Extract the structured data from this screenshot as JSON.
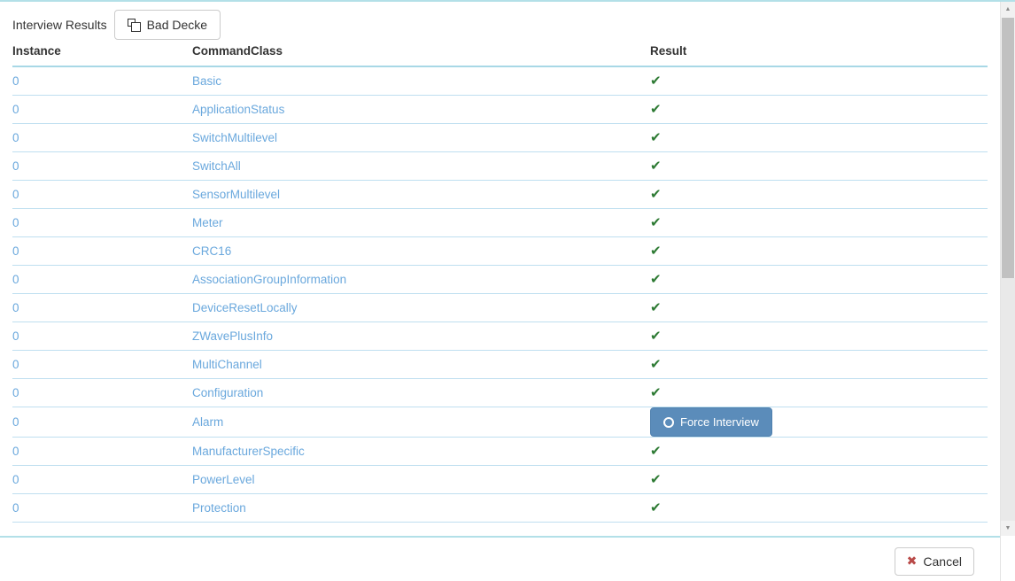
{
  "modal": {
    "title_label": "Interview Results",
    "device_button_label": "Bad Decke",
    "device_button_icon": "clone-icon"
  },
  "table": {
    "headers": {
      "instance": "Instance",
      "command_class": "CommandClass",
      "result": "Result"
    },
    "rows": [
      {
        "instance": "0",
        "command_class": "Basic",
        "result_type": "check",
        "result_icon": "check-icon"
      },
      {
        "instance": "0",
        "command_class": "ApplicationStatus",
        "result_type": "check",
        "result_icon": "check-icon"
      },
      {
        "instance": "0",
        "command_class": "SwitchMultilevel",
        "result_type": "check",
        "result_icon": "check-icon"
      },
      {
        "instance": "0",
        "command_class": "SwitchAll",
        "result_type": "check",
        "result_icon": "check-icon"
      },
      {
        "instance": "0",
        "command_class": "SensorMultilevel",
        "result_type": "check",
        "result_icon": "check-icon"
      },
      {
        "instance": "0",
        "command_class": "Meter",
        "result_type": "check",
        "result_icon": "check-icon"
      },
      {
        "instance": "0",
        "command_class": "CRC16",
        "result_type": "check",
        "result_icon": "check-icon"
      },
      {
        "instance": "0",
        "command_class": "AssociationGroupInformation",
        "result_type": "check",
        "result_icon": "check-icon"
      },
      {
        "instance": "0",
        "command_class": "DeviceResetLocally",
        "result_type": "check",
        "result_icon": "check-icon"
      },
      {
        "instance": "0",
        "command_class": "ZWavePlusInfo",
        "result_type": "check",
        "result_icon": "check-icon"
      },
      {
        "instance": "0",
        "command_class": "MultiChannel",
        "result_type": "check",
        "result_icon": "check-icon"
      },
      {
        "instance": "0",
        "command_class": "Configuration",
        "result_type": "check",
        "result_icon": "check-icon"
      },
      {
        "instance": "0",
        "command_class": "Alarm",
        "result_type": "button",
        "result_button_label": "Force Interview",
        "result_button_icon": "circle-icon"
      },
      {
        "instance": "0",
        "command_class": "ManufacturerSpecific",
        "result_type": "check",
        "result_icon": "check-icon"
      },
      {
        "instance": "0",
        "command_class": "PowerLevel",
        "result_type": "check",
        "result_icon": "check-icon"
      },
      {
        "instance": "0",
        "command_class": "Protection",
        "result_type": "check",
        "result_icon": "check-icon"
      }
    ]
  },
  "footer": {
    "cancel_label": "Cancel",
    "cancel_icon": "x-icon"
  },
  "glyphs": {
    "check": "✔",
    "cross": "✖",
    "arrow_up": "▲",
    "arrow_down": "▼"
  },
  "colors": {
    "accent_border": "#b3e0e8",
    "row_border": "#bfdff0",
    "link": "#6aa8dd",
    "check_green": "#2d7a33",
    "primary_button": "#5b8cba",
    "cancel_x_red": "#b94a48",
    "text": "#333333"
  }
}
